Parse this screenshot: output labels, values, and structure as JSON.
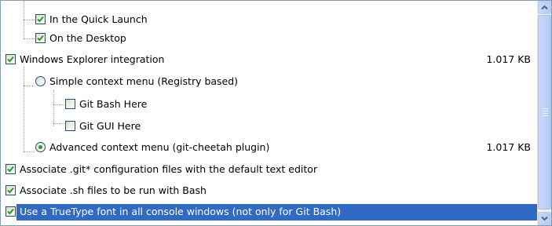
{
  "components": [
    {
      "label": "In the Quick Launch",
      "size": "",
      "control": "checkbox",
      "checked": true
    },
    {
      "label": "On the Desktop",
      "size": "",
      "control": "checkbox",
      "checked": true
    },
    {
      "label": "Windows Explorer integration",
      "size": "1.017 KB",
      "control": "checkbox",
      "checked": true
    },
    {
      "label": "Simple context menu (Registry based)",
      "size": "",
      "control": "radio",
      "checked": false
    },
    {
      "label": "Git Bash Here",
      "size": "",
      "control": "checkbox",
      "checked": false
    },
    {
      "label": "Git GUI Here",
      "size": "",
      "control": "checkbox",
      "checked": false
    },
    {
      "label": "Advanced context menu (git-cheetah plugin)",
      "size": "1.017 KB",
      "control": "radio",
      "checked": true
    },
    {
      "label": "Associate .git* configuration files with the default text editor",
      "size": "",
      "control": "checkbox",
      "checked": true
    },
    {
      "label": "Associate .sh files to be run with Bash",
      "size": "",
      "control": "checkbox",
      "checked": true
    },
    {
      "label": "Use a TrueType font in all console windows (not only for Git Bash)",
      "size": "",
      "control": "checkbox",
      "checked": true,
      "selected": true
    }
  ],
  "colors": {
    "check": "#21a121",
    "selection": "#316ac5",
    "border": "#1c5180"
  },
  "icons": {
    "scroll_up": "chevron-up-icon",
    "scroll_down": "chevron-down-icon"
  }
}
